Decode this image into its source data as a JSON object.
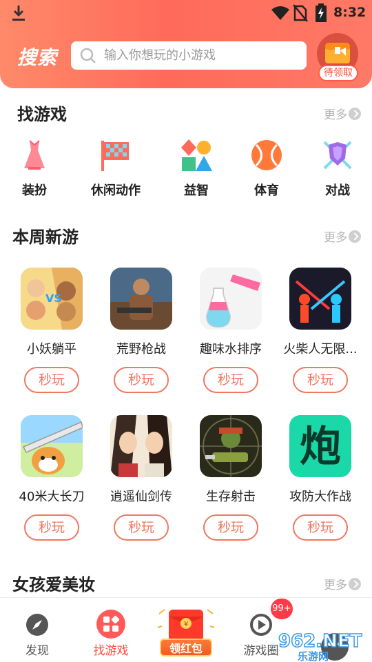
{
  "status_bar": {
    "time": "8:32"
  },
  "header": {
    "title": "搜索",
    "search_placeholder": "输入你想玩的小游戏",
    "gift_badge": "待领取"
  },
  "sections": {
    "find": {
      "title": "找游戏",
      "more": "更多"
    },
    "weekly": {
      "title": "本周新游",
      "more": "更多"
    },
    "girls": {
      "title": "女孩爱美妆",
      "more": "更多"
    }
  },
  "categories": [
    {
      "label": "装扮",
      "icon": "dress-icon"
    },
    {
      "label": "休闲动作",
      "icon": "flag-icon"
    },
    {
      "label": "益智",
      "icon": "shapes-icon"
    },
    {
      "label": "体育",
      "icon": "ball-icon"
    },
    {
      "label": "对战",
      "icon": "shield-icon"
    }
  ],
  "games": [
    {
      "name": "小妖躺平",
      "button": "秒玩"
    },
    {
      "name": "荒野枪战",
      "button": "秒玩"
    },
    {
      "name": "趣味水排序",
      "button": "秒玩"
    },
    {
      "name": "火柴人无限...",
      "button": "秒玩"
    },
    {
      "name": "40米大长刀",
      "button": "秒玩"
    },
    {
      "name": "逍遥仙剑传",
      "button": "秒玩"
    },
    {
      "name": "生存射击",
      "button": "秒玩"
    },
    {
      "name": "攻防大作战",
      "button": "秒玩"
    }
  ],
  "bottom_nav": {
    "discover": "发现",
    "find_games": "找游戏",
    "red_packet": "领红包",
    "game_circle": "游戏圈",
    "badge": "99+"
  },
  "colors": {
    "accent": "#ff6a5a",
    "button_border": "#f0765e"
  }
}
